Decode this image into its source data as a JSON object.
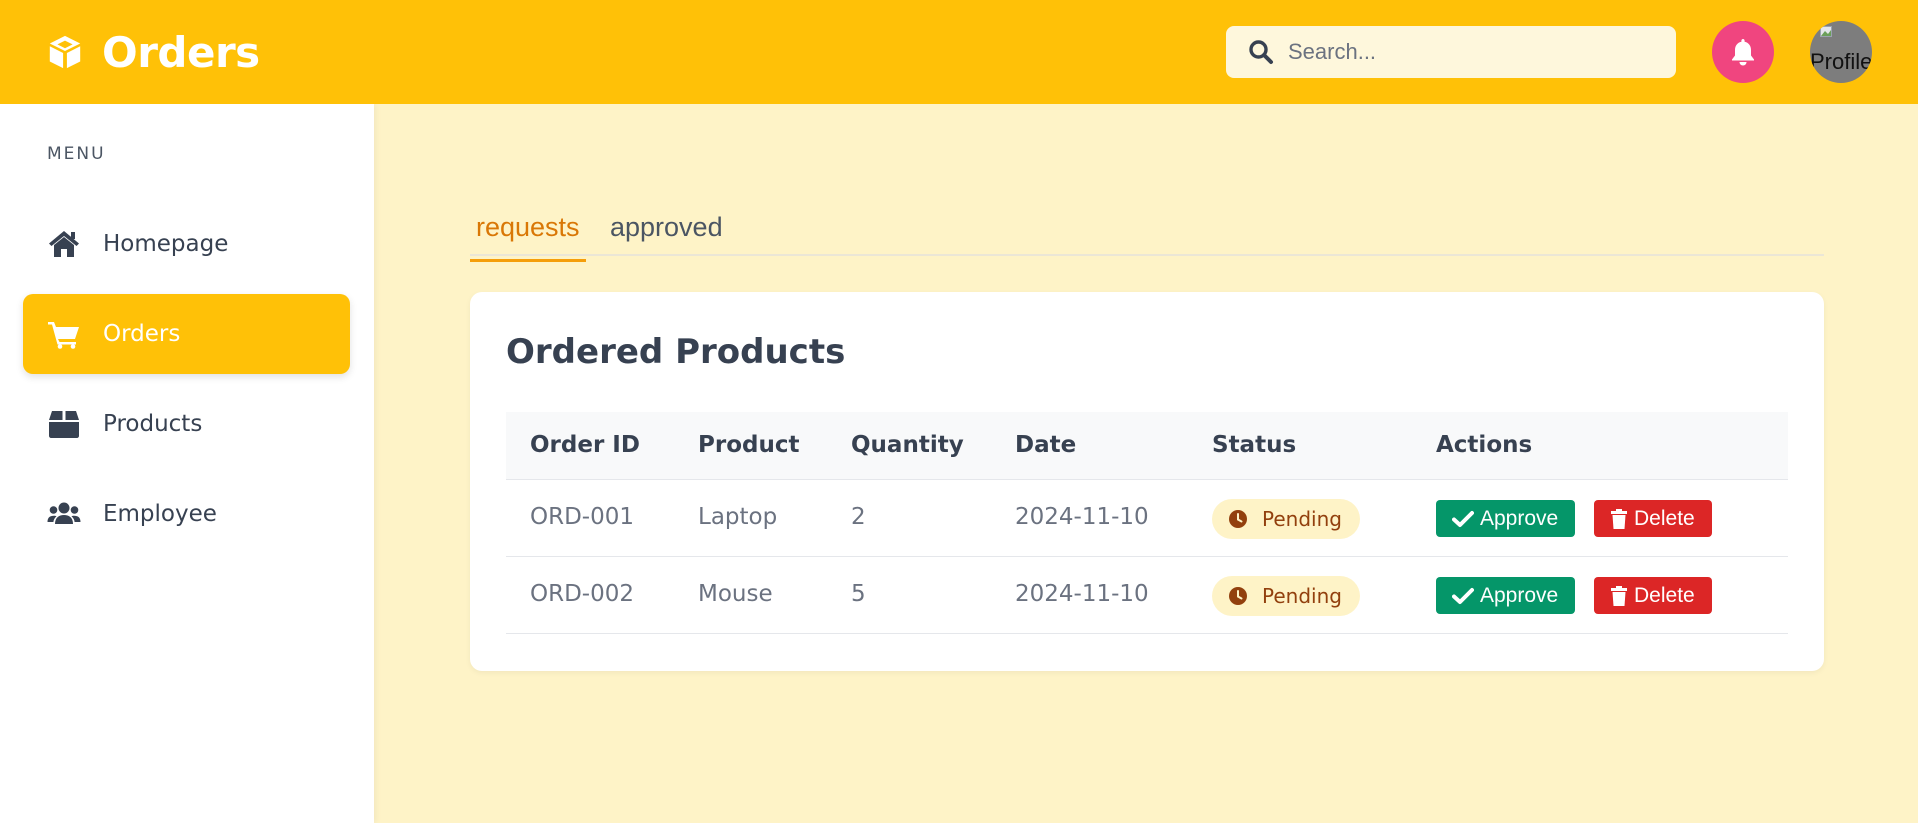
{
  "header": {
    "title": "Orders",
    "search_placeholder": "Search...",
    "avatar_alt": "Profile",
    "brand_color": "#ffc107",
    "bell_color": "#f0457f"
  },
  "sidebar": {
    "menu_label": "MENU",
    "items": [
      {
        "label": "Homepage",
        "icon": "home-icon",
        "active": false
      },
      {
        "label": "Orders",
        "icon": "cart-icon",
        "active": true
      },
      {
        "label": "Products",
        "icon": "box-icon",
        "active": false
      },
      {
        "label": "Employee",
        "icon": "users-icon",
        "active": false
      }
    ]
  },
  "tabs": [
    {
      "label": "requests",
      "active": true
    },
    {
      "label": "approved",
      "active": false
    }
  ],
  "orders_card": {
    "title": "Ordered Products",
    "columns": [
      "Order ID",
      "Product",
      "Quantity",
      "Date",
      "Status",
      "Actions"
    ],
    "rows": [
      {
        "order_id": "ORD-001",
        "product": "Laptop",
        "quantity": "2",
        "date": "2024-11-10",
        "status": "Pending",
        "approve_label": "Approve",
        "delete_label": "Delete"
      },
      {
        "order_id": "ORD-002",
        "product": "Mouse",
        "quantity": "5",
        "date": "2024-11-10",
        "status": "Pending",
        "approve_label": "Approve",
        "delete_label": "Delete"
      }
    ]
  }
}
